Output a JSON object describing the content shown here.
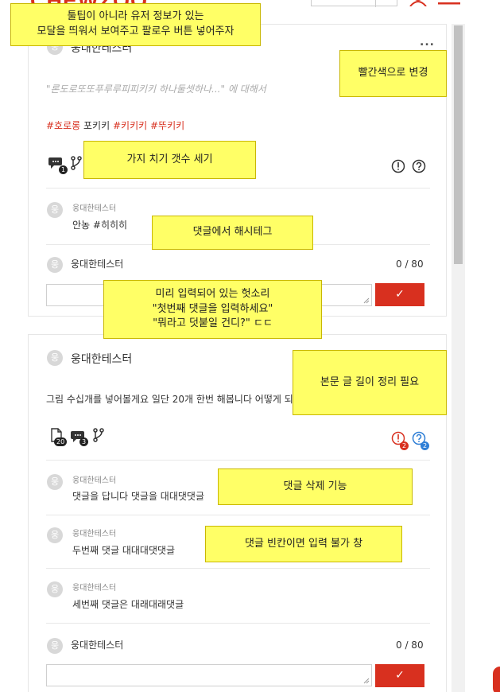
{
  "header": {
    "logo": "CHEWZOO",
    "icons": [
      "search-icon",
      "user-icon",
      "menu-icon"
    ]
  },
  "colors": {
    "accent": "#d8301f",
    "note_bg": "#ffff66"
  },
  "posts": [
    {
      "avatar_initial": "웅",
      "author": "웅대한테스터",
      "more": "...",
      "quote": "\"론도로또또푸루루피피키키 하나둘셋하나...\" 에 대해서",
      "tags": [
        {
          "text": "#호로롱",
          "color": "#d8301f"
        },
        {
          "text": "포키키",
          "color": "#333333"
        },
        {
          "text": "#키키키",
          "color": "#d8301f"
        },
        {
          "text": "#뚜키키",
          "color": "#d8301f"
        }
      ],
      "badges": {
        "comments": "1"
      },
      "comments": [
        {
          "avatar_initial": "웅",
          "author": "웅대한테스터",
          "text": "안농 #히히히"
        }
      ],
      "reply": {
        "avatar_initial": "웅",
        "author": "웅대한테스터",
        "counter": "0 / 80",
        "value": "",
        "submit": "✓"
      }
    },
    {
      "avatar_initial": "웅",
      "author": "웅대한테스터",
      "more": "...",
      "body": "그림 수십개를 넣어볼게요 일단 20개 한번 해봅니다 어떻게 되나.",
      "badges": {
        "images": "20",
        "comments": "3",
        "warnings": "2",
        "questions": "2"
      },
      "comments": [
        {
          "avatar_initial": "웅",
          "author": "웅대한테스터",
          "text": "댓글을 답니다 댓글을 대대댓댓글"
        },
        {
          "avatar_initial": "웅",
          "author": "웅대한테스터",
          "text": "두번째 댓글 대대대댓댓글"
        },
        {
          "avatar_initial": "웅",
          "author": "웅대한테스터",
          "text": "세번째 댓글은 대래대래댓글"
        }
      ],
      "reply": {
        "avatar_initial": "웅",
        "author": "웅대한테스터",
        "counter": "0 / 80",
        "value": "",
        "submit": "✓"
      }
    }
  ],
  "notes": {
    "tooltip": "툴팁이 아니라 유저 정보가 있는\n모달을 띄워서 보여주고 팔로우 버튼 넣어주자",
    "red_color": "빨간색으로 변경",
    "branch_count": "가지 치기 갯수 세기",
    "hashtag": "댓글에서 해시테그",
    "placeholder": "미리 입력되어 있는 헛소리\n\"첫번째 댓글을 입력하세요\"\n\"뭐라고 덧붙일 건디?\" ㄷㄷ",
    "body_length": "본문 글 길이 정리 필요",
    "delete": "댓글 삭제 기능",
    "empty_block": "댓글 빈칸이면 입력 불가 창"
  }
}
